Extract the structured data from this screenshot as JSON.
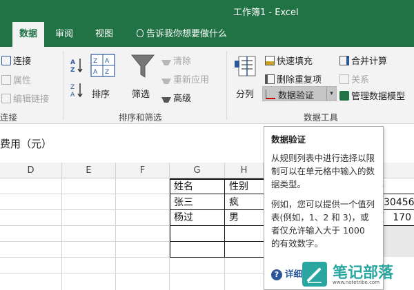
{
  "window": {
    "title": "工作簿1 - Excel"
  },
  "tabs": [
    {
      "label": "数据"
    },
    {
      "label": "审阅"
    },
    {
      "label": "视图"
    }
  ],
  "tellme": {
    "label": "告诉我你想要做什么"
  },
  "ribbon": {
    "connections": {
      "connect": "连接",
      "properties": "属性",
      "edit_links": "编辑链接",
      "group_label": "连接"
    },
    "sort_filter": {
      "sort": "排序",
      "filter": "筛选",
      "clear": "清除",
      "reapply": "重新应用",
      "advanced": "高级",
      "group_label": "排序和筛选"
    },
    "data_tools": {
      "split": "分列",
      "flash_fill": "快速填充",
      "remove_duplicates": "删除重复项",
      "data_validation": "数据验证",
      "consolidate": "合并计算",
      "relationships": "关系",
      "manage_model": "管理数据模型",
      "group_label": "数据工具"
    }
  },
  "formula_bar": {
    "text": "费用（元）"
  },
  "columns": [
    "D",
    "E",
    "F",
    "G",
    "H"
  ],
  "cells": {
    "g1": "姓名",
    "h1": "性别",
    "g2": "张三",
    "h2": "疯",
    "g3": "杨过",
    "h3": "男",
    "i1_fragment": "元)",
    "i2_fragment": "30456",
    "i3_fragment": "170"
  },
  "tooltip": {
    "title": "数据验证",
    "body1": "从规则列表中进行选择以限制可以在单元格中输入的数据类型。",
    "body2": "例如，您可以提供一个值列表(例如，1、2 和 3)，或者仅允许输入大于 1000 的有效数字。",
    "more": "详细"
  },
  "watermark": {
    "text": "笔记部落",
    "url": "www.notetribe.com"
  },
  "colors": {
    "accent": "#217346",
    "watermark": "#2aa6a0"
  }
}
